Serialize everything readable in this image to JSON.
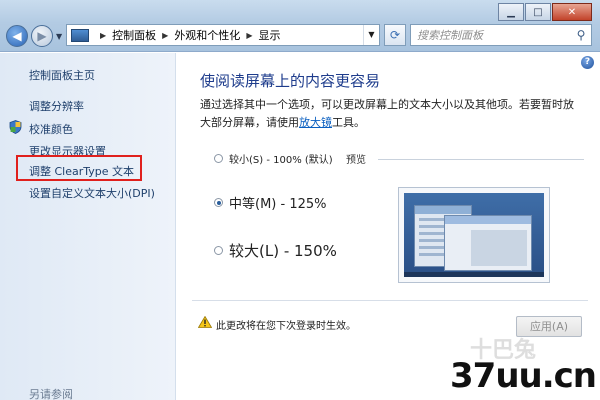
{
  "window": {
    "minimize_icon": "minimize-icon",
    "maximize_icon": "maximize-icon",
    "close_icon": "close-icon"
  },
  "address_bar": {
    "breadcrumbs": [
      "控制面板",
      "外观和个性化",
      "显示"
    ],
    "search_placeholder": "搜索控制面板"
  },
  "sidebar": {
    "home": "控制面板主页",
    "items": [
      "调整分辨率",
      "校准颜色",
      "更改显示器设置",
      "调整 ClearType 文本",
      "设置自定义文本大小(DPI)"
    ],
    "highlighted_item": "调整 ClearType 文本",
    "highlight_color": "#e0201d",
    "see_also": "另请参阅"
  },
  "content": {
    "heading": "使阅读屏幕上的内容更容易",
    "description_before_link": "通过选择其中一个选项，可以更改屏幕上的文本大小以及其他项。若要暂时放大部分屏幕，请使用",
    "description_link": "放大镜",
    "description_after_link": "工具。",
    "options": [
      {
        "label": "较小(S) - 100% (默认)",
        "selected": false
      },
      {
        "label": "中等(M) - 125%",
        "selected": true
      },
      {
        "label": "较大(L) - 150%",
        "selected": false
      }
    ],
    "preview_label": "预览",
    "warning": "此更改将在您下次登录时生效。",
    "apply_button": "应用(A)"
  },
  "watermark": {
    "text": "37uu.cn",
    "ghost": "十巴兔"
  }
}
